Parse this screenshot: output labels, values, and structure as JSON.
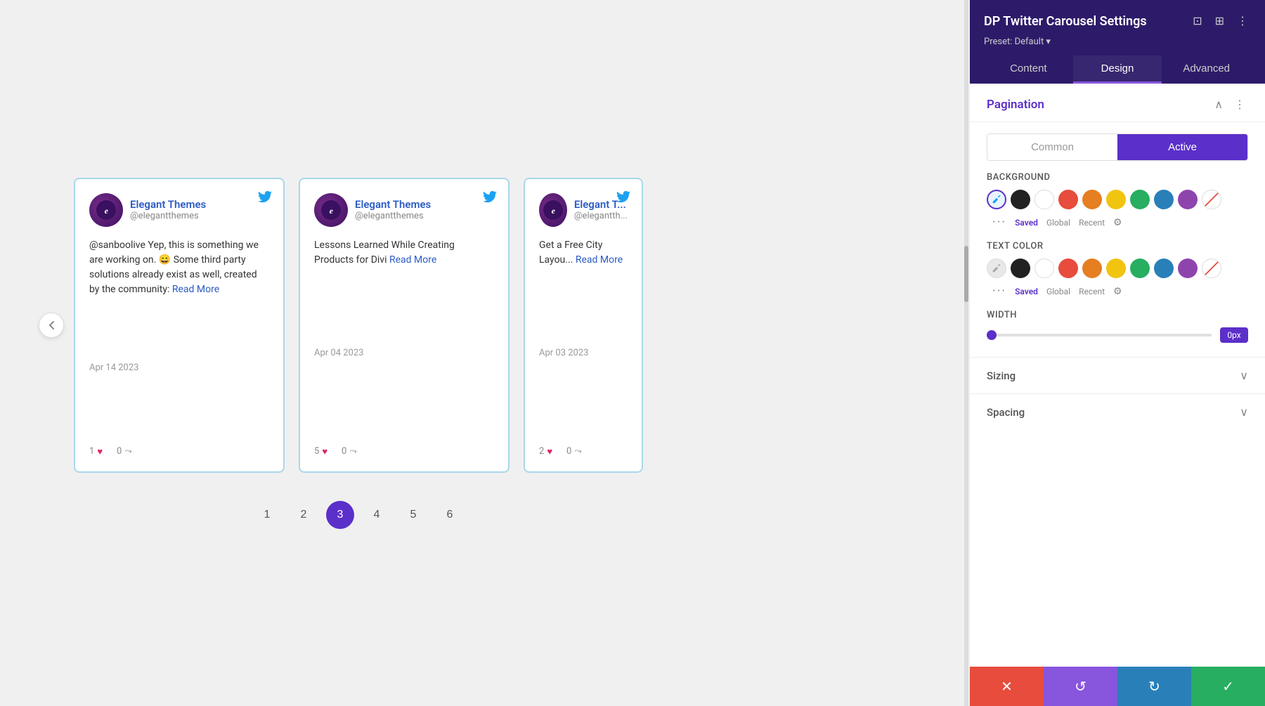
{
  "panel": {
    "title": "DP Twitter Carousel Settings",
    "preset": "Preset: Default ▾",
    "tabs": [
      {
        "id": "content",
        "label": "Content"
      },
      {
        "id": "design",
        "label": "Design"
      },
      {
        "id": "advanced",
        "label": "Advanced"
      }
    ],
    "active_tab": "design",
    "section": {
      "title": "Pagination",
      "sub_tabs": [
        {
          "id": "common",
          "label": "Common"
        },
        {
          "id": "active",
          "label": "Active"
        }
      ],
      "active_sub_tab": "active"
    },
    "background": {
      "label": "Background",
      "colors": [
        "eyedropper",
        "black",
        "white",
        "red",
        "orange",
        "yellow",
        "green",
        "teal",
        "purple",
        "cross"
      ],
      "meta": [
        "Saved",
        "Global",
        "Recent"
      ]
    },
    "text_color": {
      "label": "Text Color",
      "colors": [
        "eyedropper-light",
        "black",
        "white",
        "red",
        "orange",
        "yellow",
        "green",
        "teal",
        "purple",
        "cross"
      ],
      "meta": [
        "Saved",
        "Global",
        "Recent"
      ]
    },
    "width": {
      "label": "Width",
      "value": "0px",
      "min": 0,
      "max": 100
    },
    "sizing": {
      "label": "Sizing"
    },
    "spacing": {
      "label": "Spacing"
    }
  },
  "cards": [
    {
      "id": 1,
      "user": "Elegant Themes",
      "handle": "@elegantthemes",
      "text": "@sanboolive Yep, this is something we are working on. 😄 Some third party solutions already exist as well, created by the community:",
      "read_more": "Read More",
      "date": "Apr 14 2023",
      "likes": "1",
      "shares": "0"
    },
    {
      "id": 2,
      "user": "Elegant Themes",
      "handle": "@elegantthemes",
      "text": "Lessons Learned While Creating Products for Divi",
      "read_more": "Read More",
      "date": "Apr 04 2023",
      "likes": "5",
      "shares": "0"
    },
    {
      "id": 3,
      "user": "Elegant T...",
      "handle": "@elegantth...",
      "text": "Get a Free City Layou...",
      "read_more": "Read More",
      "date": "Apr 03 2023",
      "likes": "2",
      "shares": "0"
    }
  ],
  "pagination": {
    "pages": [
      "1",
      "2",
      "3",
      "4",
      "5",
      "6"
    ],
    "active_page": "3"
  },
  "toolbar": {
    "cancel": "✕",
    "undo": "↺",
    "redo": "↻",
    "confirm": "✓"
  }
}
